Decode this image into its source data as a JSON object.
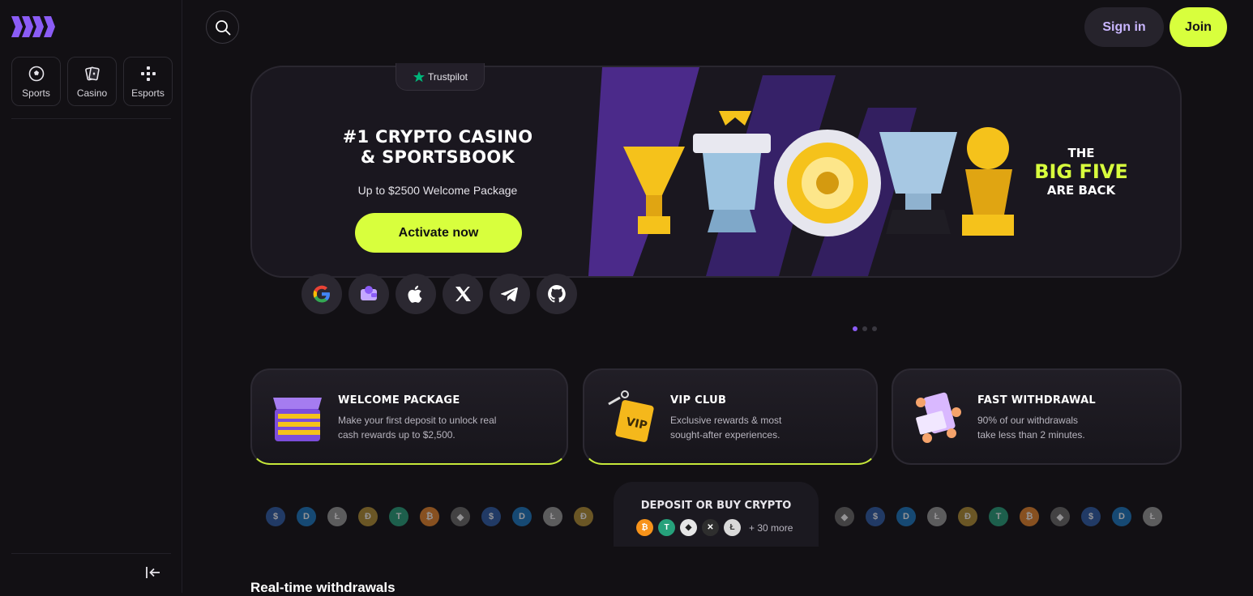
{
  "sidebar": {
    "nav": [
      {
        "label": "Sports",
        "icon": "soccer-ball-icon"
      },
      {
        "label": "Casino",
        "icon": "playing-cards-icon"
      },
      {
        "label": "Esports",
        "icon": "gamepad-icon"
      }
    ]
  },
  "header": {
    "signin_label": "Sign in",
    "join_label": "Join"
  },
  "hero": {
    "trustpilot": "Trustpilot",
    "title_line1": "#1 CRYPTO CASINO",
    "title_line2": "& SPORTSBOOK",
    "subtitle": "Up to $2500 Welcome Package",
    "cta": "Activate now",
    "banner_line1": "THE",
    "banner_line2": "BIG FIVE",
    "banner_line3": "ARE BACK",
    "slides": 3,
    "active_slide": 1
  },
  "socials": [
    "google-icon",
    "wallet-icon",
    "apple-icon",
    "x-icon",
    "telegram-icon",
    "github-icon"
  ],
  "features": [
    {
      "title": "WELCOME PACKAGE",
      "desc1": "Make your first deposit to unlock real",
      "desc2": "cash rewards up to $2,500."
    },
    {
      "title": "VIP CLUB",
      "desc1": "Exclusive rewards & most",
      "desc2": "sought-after experiences."
    },
    {
      "title": "FAST WITHDRAWAL",
      "desc1": "90% of our withdrawals",
      "desc2": "take less than 2 minutes."
    }
  ],
  "deposit": {
    "title": "DEPOSIT OR BUY CRYPTO",
    "more": "+ 30 more"
  },
  "section": {
    "realtime_title": "Real-time withdrawals"
  },
  "colors": {
    "accent": "#d8ff3d",
    "purple": "#8b5cf6",
    "bg": "#121014"
  }
}
